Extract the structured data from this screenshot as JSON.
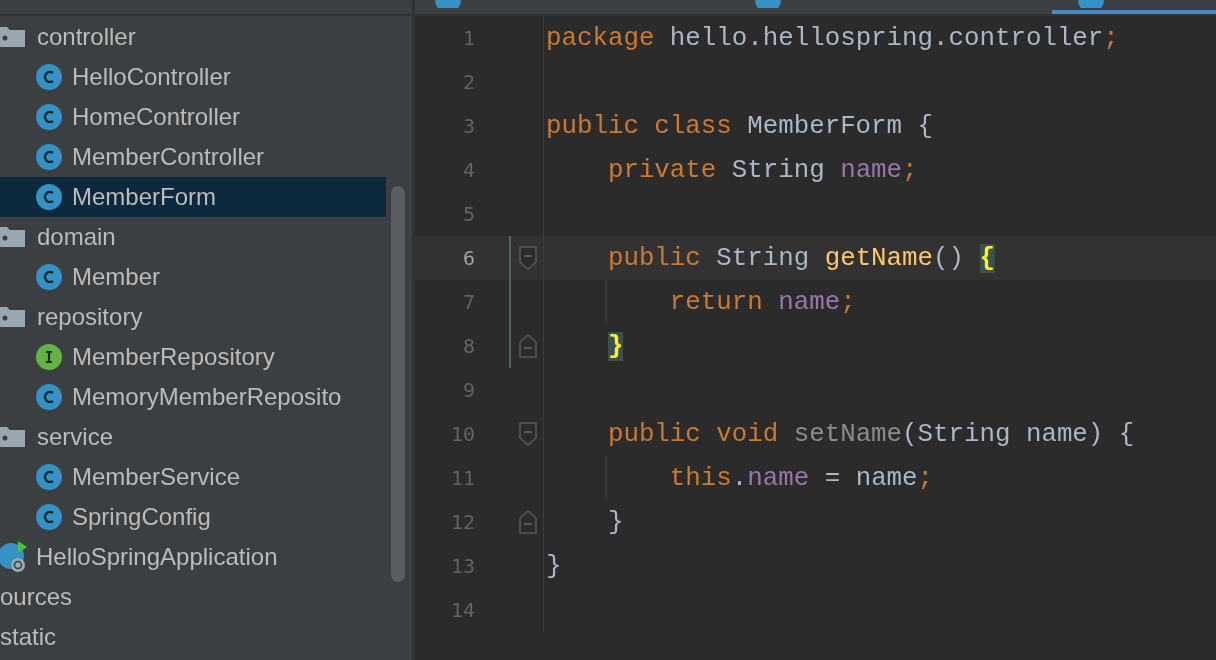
{
  "tabs": [
    {
      "selected": false
    },
    {
      "selected": false
    },
    {
      "selected": true
    }
  ],
  "project_tree": [
    {
      "kind": "folder",
      "label": "controller",
      "selected": false,
      "children": [
        {
          "kind": "class",
          "label": "HelloController",
          "selected": false
        },
        {
          "kind": "class",
          "label": "HomeController",
          "selected": false
        },
        {
          "kind": "class",
          "label": "MemberController",
          "selected": false
        },
        {
          "kind": "class",
          "label": "MemberForm",
          "selected": true
        }
      ]
    },
    {
      "kind": "folder",
      "label": "domain",
      "selected": false,
      "children": [
        {
          "kind": "class",
          "label": "Member",
          "selected": false
        }
      ]
    },
    {
      "kind": "folder",
      "label": "repository",
      "selected": false,
      "children": [
        {
          "kind": "interface",
          "label": "MemberRepository",
          "selected": false
        },
        {
          "kind": "class",
          "label": "MemoryMemberReposito",
          "selected": false
        }
      ]
    },
    {
      "kind": "folder",
      "label": "service",
      "selected": false,
      "children": [
        {
          "kind": "class",
          "label": "MemberService",
          "selected": false
        },
        {
          "kind": "class",
          "label": "SpringConfig",
          "selected": false
        }
      ]
    },
    {
      "kind": "app",
      "label": "HelloSpringApplication",
      "selected": false
    },
    {
      "kind": "text",
      "label": "ources",
      "selected": false
    },
    {
      "kind": "text",
      "label": "static",
      "selected": false
    }
  ],
  "code_lines": [
    {
      "number": "1",
      "current": false,
      "changed": false,
      "tokens": [
        {
          "kind": "keyword",
          "text": "package "
        },
        {
          "kind": "plain",
          "text": "hello.hellospring.controller"
        },
        {
          "kind": "keyword",
          "text": ";"
        }
      ]
    },
    {
      "number": "2",
      "current": false,
      "changed": false
    },
    {
      "number": "3",
      "current": false,
      "changed": false,
      "tokens": [
        {
          "kind": "keyword",
          "text": "public class "
        },
        {
          "kind": "plain",
          "text": "MemberForm {"
        }
      ]
    },
    {
      "number": "4",
      "current": false,
      "changed": false,
      "tokens": [
        {
          "kind": "keyword",
          "text": "    private "
        },
        {
          "kind": "plain",
          "text": "String "
        },
        {
          "kind": "field",
          "text": "name"
        },
        {
          "kind": "keyword",
          "text": ";"
        }
      ]
    },
    {
      "number": "5",
      "current": false,
      "changed": false
    },
    {
      "number": "6",
      "current": true,
      "changed": true,
      "fold_start": true,
      "tokens": [
        {
          "kind": "keyword",
          "text": "    public "
        },
        {
          "kind": "plain",
          "text": "String "
        },
        {
          "kind": "method",
          "text": "getName"
        },
        {
          "kind": "plain",
          "text": "() "
        },
        {
          "kind": "brace-match",
          "text": "{"
        }
      ]
    },
    {
      "number": "7",
      "current": false,
      "changed": true,
      "guide": true,
      "tokens": [
        {
          "kind": "keyword",
          "text": "        return "
        },
        {
          "kind": "field",
          "text": "name"
        },
        {
          "kind": "keyword",
          "text": ";"
        }
      ]
    },
    {
      "number": "8",
      "current": false,
      "changed": true,
      "fold_end": true,
      "tokens": [
        {
          "kind": "brace-match",
          "text": "    }"
        }
      ]
    },
    {
      "number": "9",
      "current": false,
      "changed": false
    },
    {
      "number": "10",
      "current": false,
      "changed": false,
      "fold_start": true,
      "tokens": [
        {
          "kind": "keyword",
          "text": "    public void "
        },
        {
          "kind": "unused",
          "text": "setName"
        },
        {
          "kind": "plain",
          "text": "(String name) {"
        }
      ]
    },
    {
      "number": "11",
      "current": false,
      "changed": false,
      "guide": true,
      "tokens": [
        {
          "kind": "keyword",
          "text": "        this"
        },
        {
          "kind": "plain",
          "text": "."
        },
        {
          "kind": "field",
          "text": "name"
        },
        {
          "kind": "plain",
          "text": " = name"
        },
        {
          "kind": "keyword",
          "text": ";"
        }
      ]
    },
    {
      "number": "12",
      "current": false,
      "changed": false,
      "fold_end": true,
      "tokens": [
        {
          "kind": "plain",
          "text": "    }"
        }
      ]
    },
    {
      "number": "13",
      "current": false,
      "changed": false,
      "tokens": [
        {
          "kind": "plain",
          "text": "}"
        }
      ]
    },
    {
      "number": "14",
      "current": false,
      "changed": false
    }
  ]
}
